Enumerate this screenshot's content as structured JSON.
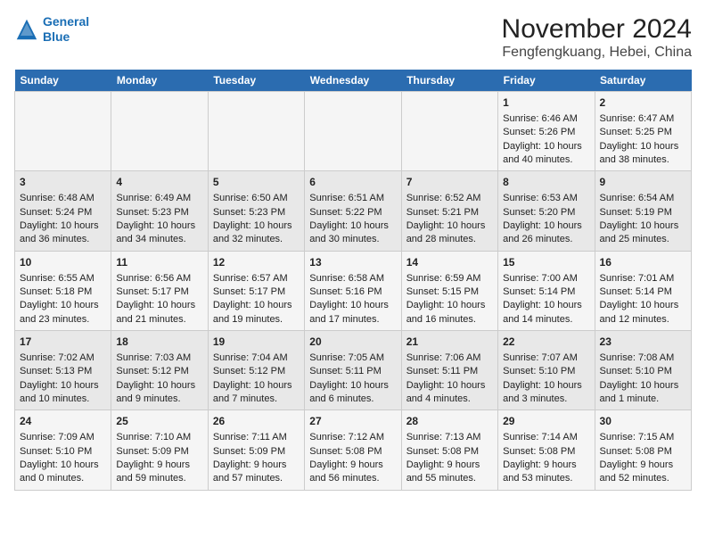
{
  "header": {
    "logo_line1": "General",
    "logo_line2": "Blue",
    "title": "November 2024",
    "subtitle": "Fengfengkuang, Hebei, China"
  },
  "weekdays": [
    "Sunday",
    "Monday",
    "Tuesday",
    "Wednesday",
    "Thursday",
    "Friday",
    "Saturday"
  ],
  "weeks": [
    [
      {
        "day": "",
        "info": ""
      },
      {
        "day": "",
        "info": ""
      },
      {
        "day": "",
        "info": ""
      },
      {
        "day": "",
        "info": ""
      },
      {
        "day": "",
        "info": ""
      },
      {
        "day": "1",
        "info": "Sunrise: 6:46 AM\nSunset: 5:26 PM\nDaylight: 10 hours and 40 minutes."
      },
      {
        "day": "2",
        "info": "Sunrise: 6:47 AM\nSunset: 5:25 PM\nDaylight: 10 hours and 38 minutes."
      }
    ],
    [
      {
        "day": "3",
        "info": "Sunrise: 6:48 AM\nSunset: 5:24 PM\nDaylight: 10 hours and 36 minutes."
      },
      {
        "day": "4",
        "info": "Sunrise: 6:49 AM\nSunset: 5:23 PM\nDaylight: 10 hours and 34 minutes."
      },
      {
        "day": "5",
        "info": "Sunrise: 6:50 AM\nSunset: 5:23 PM\nDaylight: 10 hours and 32 minutes."
      },
      {
        "day": "6",
        "info": "Sunrise: 6:51 AM\nSunset: 5:22 PM\nDaylight: 10 hours and 30 minutes."
      },
      {
        "day": "7",
        "info": "Sunrise: 6:52 AM\nSunset: 5:21 PM\nDaylight: 10 hours and 28 minutes."
      },
      {
        "day": "8",
        "info": "Sunrise: 6:53 AM\nSunset: 5:20 PM\nDaylight: 10 hours and 26 minutes."
      },
      {
        "day": "9",
        "info": "Sunrise: 6:54 AM\nSunset: 5:19 PM\nDaylight: 10 hours and 25 minutes."
      }
    ],
    [
      {
        "day": "10",
        "info": "Sunrise: 6:55 AM\nSunset: 5:18 PM\nDaylight: 10 hours and 23 minutes."
      },
      {
        "day": "11",
        "info": "Sunrise: 6:56 AM\nSunset: 5:17 PM\nDaylight: 10 hours and 21 minutes."
      },
      {
        "day": "12",
        "info": "Sunrise: 6:57 AM\nSunset: 5:17 PM\nDaylight: 10 hours and 19 minutes."
      },
      {
        "day": "13",
        "info": "Sunrise: 6:58 AM\nSunset: 5:16 PM\nDaylight: 10 hours and 17 minutes."
      },
      {
        "day": "14",
        "info": "Sunrise: 6:59 AM\nSunset: 5:15 PM\nDaylight: 10 hours and 16 minutes."
      },
      {
        "day": "15",
        "info": "Sunrise: 7:00 AM\nSunset: 5:14 PM\nDaylight: 10 hours and 14 minutes."
      },
      {
        "day": "16",
        "info": "Sunrise: 7:01 AM\nSunset: 5:14 PM\nDaylight: 10 hours and 12 minutes."
      }
    ],
    [
      {
        "day": "17",
        "info": "Sunrise: 7:02 AM\nSunset: 5:13 PM\nDaylight: 10 hours and 10 minutes."
      },
      {
        "day": "18",
        "info": "Sunrise: 7:03 AM\nSunset: 5:12 PM\nDaylight: 10 hours and 9 minutes."
      },
      {
        "day": "19",
        "info": "Sunrise: 7:04 AM\nSunset: 5:12 PM\nDaylight: 10 hours and 7 minutes."
      },
      {
        "day": "20",
        "info": "Sunrise: 7:05 AM\nSunset: 5:11 PM\nDaylight: 10 hours and 6 minutes."
      },
      {
        "day": "21",
        "info": "Sunrise: 7:06 AM\nSunset: 5:11 PM\nDaylight: 10 hours and 4 minutes."
      },
      {
        "day": "22",
        "info": "Sunrise: 7:07 AM\nSunset: 5:10 PM\nDaylight: 10 hours and 3 minutes."
      },
      {
        "day": "23",
        "info": "Sunrise: 7:08 AM\nSunset: 5:10 PM\nDaylight: 10 hours and 1 minute."
      }
    ],
    [
      {
        "day": "24",
        "info": "Sunrise: 7:09 AM\nSunset: 5:10 PM\nDaylight: 10 hours and 0 minutes."
      },
      {
        "day": "25",
        "info": "Sunrise: 7:10 AM\nSunset: 5:09 PM\nDaylight: 9 hours and 59 minutes."
      },
      {
        "day": "26",
        "info": "Sunrise: 7:11 AM\nSunset: 5:09 PM\nDaylight: 9 hours and 57 minutes."
      },
      {
        "day": "27",
        "info": "Sunrise: 7:12 AM\nSunset: 5:08 PM\nDaylight: 9 hours and 56 minutes."
      },
      {
        "day": "28",
        "info": "Sunrise: 7:13 AM\nSunset: 5:08 PM\nDaylight: 9 hours and 55 minutes."
      },
      {
        "day": "29",
        "info": "Sunrise: 7:14 AM\nSunset: 5:08 PM\nDaylight: 9 hours and 53 minutes."
      },
      {
        "day": "30",
        "info": "Sunrise: 7:15 AM\nSunset: 5:08 PM\nDaylight: 9 hours and 52 minutes."
      }
    ]
  ]
}
